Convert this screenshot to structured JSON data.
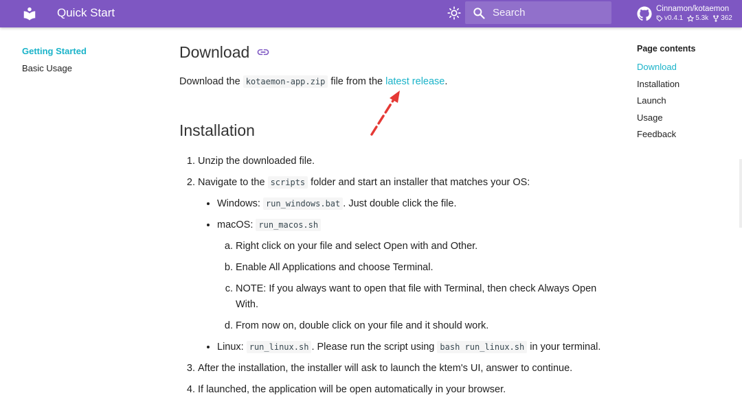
{
  "header": {
    "title": "Quick Start",
    "search_placeholder": "Search",
    "repo": {
      "name": "Cinnamon/kotaemon",
      "version": "v0.4.1",
      "stars": "5.3k",
      "forks": "362"
    },
    "colors": {
      "bar": "#7e57c2",
      "accent": "#1ab3c9"
    }
  },
  "left_nav": {
    "items": [
      {
        "label": "Getting Started",
        "active": true
      },
      {
        "label": "Basic Usage",
        "active": false
      }
    ]
  },
  "toc": {
    "title": "Page contents",
    "items": [
      "Download",
      "Installation",
      "Launch",
      "Usage",
      "Feedback"
    ]
  },
  "content": {
    "download": {
      "heading": "Download",
      "text_before": "Download the ",
      "file": "kotaemon-app.zip",
      "text_mid": " file from the ",
      "link": "latest release",
      "text_after": "."
    },
    "installation": {
      "heading": "Installation",
      "step1": "Unzip the downloaded file.",
      "step2_before": "Navigate to the ",
      "step2_code": "scripts",
      "step2_after": " folder and start an installer that matches your OS:",
      "windows_label": "Windows: ",
      "windows_code": "run_windows.bat",
      "windows_after": ". Just double click the file.",
      "macos_label": "macOS: ",
      "macos_code": "run_macos.sh",
      "mac_steps": [
        "Right click on your file and select Open with and Other.",
        "Enable All Applications and choose Terminal.",
        "NOTE: If you always want to open that file with Terminal, then check Always Open With.",
        "From now on, double click on your file and it should work."
      ],
      "linux_label": "Linux: ",
      "linux_code": "run_linux.sh",
      "linux_mid": ". Please run the script using ",
      "linux_cmd": "bash run_linux.sh",
      "linux_after": " in your terminal.",
      "step3": "After the installation, the installer will ask to launch the ktem's UI, answer to continue.",
      "step4": "If launched, the application will be open automatically in your browser."
    }
  }
}
